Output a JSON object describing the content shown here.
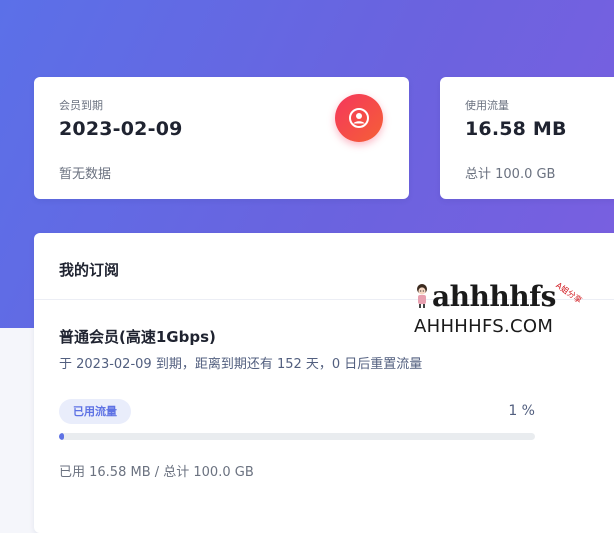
{
  "cards": {
    "membership": {
      "label": "会员到期",
      "value": "2023-02-09",
      "sub": "暂无数据",
      "icon": "user-avatar-icon",
      "icon_color": "#f5365c"
    },
    "traffic": {
      "label": "使用流量",
      "value": "16.58 MB",
      "sub": "总计 100.0 GB"
    }
  },
  "subscription": {
    "title": "我的订阅",
    "plan_name": "普通会员(高速1Gbps)",
    "plan_desc": "于 2023-02-09 到期，距离到期还有 152 天，0 日后重置流量",
    "usage_badge": "已用流量",
    "usage_percent_label": "1 %",
    "usage_fraction": 0.01,
    "usage_detail": "已用 16.58 MB / 总计 100.0 GB"
  },
  "watermark": {
    "logo_text": "ahhhhfs",
    "tag": "A姐分享",
    "domain": "AHHHHFS.COM"
  },
  "colors": {
    "hero_gradient_start": "#5b70e8",
    "hero_gradient_end": "#7a5fe0",
    "accent": "#5e72e4",
    "avatar_gradient_start": "#f5365c",
    "avatar_gradient_end": "#f56036"
  }
}
